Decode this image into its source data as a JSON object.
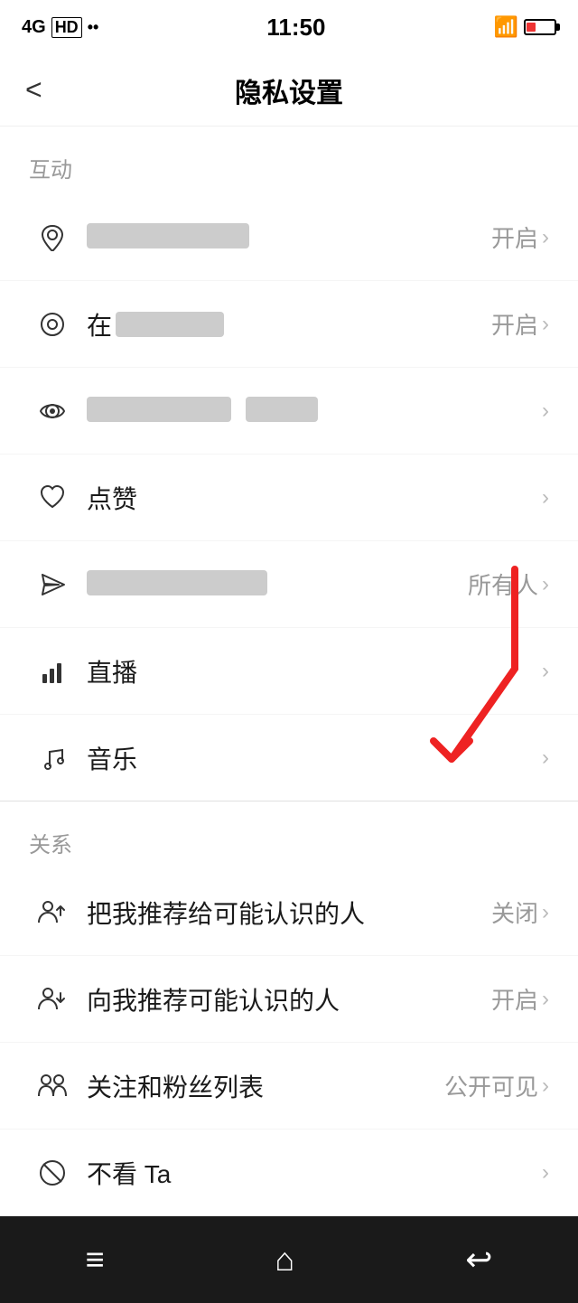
{
  "statusBar": {
    "time": "11:50",
    "signal": "4G",
    "hd": "HD"
  },
  "navBar": {
    "backLabel": "<",
    "title": "隐私设置"
  },
  "sections": [
    {
      "label": "互动",
      "items": [
        {
          "icon": "📍",
          "iconName": "location-icon",
          "text": "",
          "blurred": true,
          "blurClass": "b1",
          "rightText": "开启",
          "rightArrow": true
        },
        {
          "icon": "◎",
          "iconName": "online-icon",
          "text": "在",
          "blurred": true,
          "blurClass": "b2",
          "rightText": "开启",
          "rightArrow": true
        },
        {
          "icon": "👁",
          "iconName": "view-icon",
          "text": "",
          "blurred": true,
          "blurClass": "b3",
          "rightText": "",
          "rightArrow": true
        },
        {
          "icon": "♡",
          "iconName": "like-icon",
          "text": "点赞",
          "blurred": false,
          "rightText": "",
          "rightArrow": true
        },
        {
          "icon": "✉",
          "iconName": "message-icon",
          "text": "",
          "blurred": true,
          "blurClass": "b5",
          "rightText": "所有人",
          "rightArrow": true,
          "hasRedArrow": true
        },
        {
          "icon": "📊",
          "iconName": "live-icon",
          "text": "直播",
          "blurred": false,
          "rightText": "",
          "rightArrow": true
        },
        {
          "icon": "♪",
          "iconName": "music-icon",
          "text": "音乐",
          "blurred": false,
          "rightText": "",
          "rightArrow": true
        }
      ]
    },
    {
      "label": "关系",
      "items": [
        {
          "icon": "👤+",
          "iconName": "recommend-to-icon",
          "text": "把我推荐给可能认识的人",
          "blurred": false,
          "rightText": "关闭",
          "rightArrow": true
        },
        {
          "icon": "👤↔",
          "iconName": "recommend-from-icon",
          "text": "向我推荐可能认识的人",
          "blurred": false,
          "rightText": "开启",
          "rightArrow": true
        },
        {
          "icon": "👥",
          "iconName": "fans-list-icon",
          "text": "关注和粉丝列表",
          "blurred": false,
          "rightText": "公开可见",
          "rightArrow": true
        },
        {
          "icon": "🚫",
          "iconName": "block-icon",
          "text": "不看 Ta",
          "blurred": false,
          "rightText": "",
          "rightArrow": true
        }
      ]
    }
  ],
  "bottomBar": {
    "menu": "≡",
    "home": "⌂",
    "back": "↩"
  }
}
